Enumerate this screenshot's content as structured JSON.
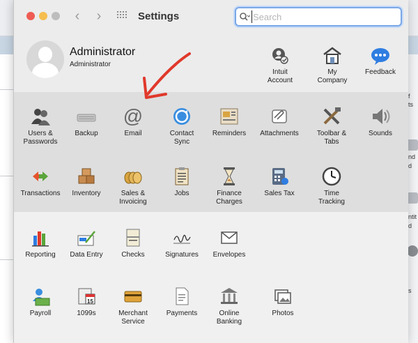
{
  "window": {
    "title": "Settings",
    "nav_back_glyph": "‹",
    "nav_forward_glyph": "›"
  },
  "search": {
    "placeholder": "Search",
    "value": "",
    "icon": "search-icon"
  },
  "account": {
    "name": "Administrator",
    "role": "Administrator",
    "links": [
      {
        "label": "Intuit\nAccount",
        "icon": "intuit-account-icon"
      },
      {
        "label": "My\nCompany",
        "icon": "my-company-icon"
      },
      {
        "label": "Feedback",
        "icon": "feedback-icon"
      }
    ]
  },
  "row1": [
    {
      "label": "Users &\nPasswords",
      "icon": "users-icon"
    },
    {
      "label": "Backup",
      "icon": "backup-icon"
    },
    {
      "label": "Email",
      "icon": "email-icon"
    },
    {
      "label": "Contact\nSync",
      "icon": "contact-sync-icon"
    },
    {
      "label": "Reminders",
      "icon": "reminders-icon"
    },
    {
      "label": "Attachments",
      "icon": "attachments-icon"
    },
    {
      "label": "Toolbar &\nTabs",
      "icon": "toolbar-icon"
    },
    {
      "label": "Sounds",
      "icon": "sounds-icon"
    }
  ],
  "row2": [
    {
      "label": "Transactions",
      "icon": "transactions-icon"
    },
    {
      "label": "Inventory",
      "icon": "inventory-icon"
    },
    {
      "label": "Sales &\nInvoicing",
      "icon": "sales-icon"
    },
    {
      "label": "Jobs",
      "icon": "jobs-icon"
    },
    {
      "label": "Finance\nCharges",
      "icon": "finance-charges-icon"
    },
    {
      "label": "Sales Tax",
      "icon": "sales-tax-icon"
    },
    {
      "label": "Time\nTracking",
      "icon": "time-tracking-icon"
    }
  ],
  "row3": [
    {
      "label": "Reporting",
      "icon": "reporting-icon"
    },
    {
      "label": "Data Entry",
      "icon": "data-entry-icon"
    },
    {
      "label": "Checks",
      "icon": "checks-icon"
    },
    {
      "label": "Signatures",
      "icon": "signatures-icon"
    },
    {
      "label": "Envelopes",
      "icon": "envelopes-icon"
    }
  ],
  "row4": [
    {
      "label": "Payroll",
      "icon": "payroll-icon"
    },
    {
      "label": "1099s",
      "icon": "1099s-icon"
    },
    {
      "label": "Merchant\nService",
      "icon": "merchant-service-icon"
    },
    {
      "label": "Payments",
      "icon": "payments-icon"
    },
    {
      "label": "Online\nBanking",
      "icon": "online-banking-icon"
    },
    {
      "label": "Photos",
      "icon": "photos-icon"
    }
  ],
  "background": {
    "fragments": [
      "f",
      "ts",
      "nd",
      "d",
      "ntit",
      "d",
      "s"
    ]
  },
  "colors": {
    "close": "#ee5c54",
    "minimize": "#f5be4f",
    "annotation": "#e0392b",
    "search_focus": "#7aa7e6"
  }
}
